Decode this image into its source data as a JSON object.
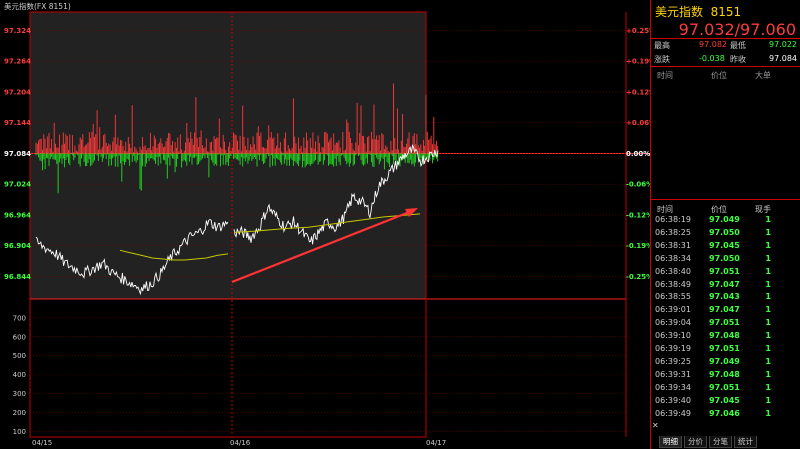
{
  "window": {
    "title": "美元指数(FX 8151)"
  },
  "chart_data": {
    "type": "line",
    "title": "美元指数(FX 8151)",
    "price_axis": [
      "97.324",
      "97.264",
      "97.204",
      "97.144",
      "97.084",
      "97.024",
      "96.964",
      "96.904",
      "96.844"
    ],
    "percent_axis": [
      "+0.25%",
      "+0.19%",
      "+0.12%",
      "+0.06%",
      "0.00%",
      "-0.06%",
      "-0.12%",
      "-0.19%",
      "-0.25%"
    ],
    "volume_axis": [
      "700",
      "600",
      "500",
      "400",
      "300",
      "200",
      "100"
    ],
    "date_labels": [
      "04/15",
      "04/16",
      "04/17"
    ],
    "ylim": [
      96.8,
      97.36
    ],
    "reference_price": 97.084,
    "series": [
      {
        "values": [
          96.91,
          96.9,
          96.89,
          96.87,
          96.86,
          96.85,
          96.86,
          96.87,
          96.85,
          96.84,
          96.83,
          96.82,
          96.83,
          96.85,
          96.88,
          96.9,
          96.92,
          96.93,
          96.95,
          96.94,
          96.95
        ]
      },
      {
        "values": [
          96.93,
          96.93,
          96.92,
          96.94,
          96.98,
          96.96,
          96.94,
          96.95,
          96.93,
          96.91,
          96.93,
          96.95,
          96.94,
          96.96,
          97.0,
          96.99,
          96.97,
          97.02,
          97.04,
          97.06,
          97.08,
          97.09,
          97.07,
          97.08,
          97.09
        ]
      },
      {
        "values": [
          96.895,
          96.89,
          96.885,
          96.88,
          96.878,
          96.876,
          96.876,
          96.878,
          96.88,
          96.885,
          96.888
        ]
      },
      {
        "values": [
          96.93,
          96.932,
          96.935,
          96.938,
          96.94,
          96.945,
          96.95,
          96.955,
          96.96,
          96.963,
          96.966
        ]
      }
    ]
  },
  "quote": {
    "name": "美元指数",
    "code": "8151",
    "price": "97.032/97.060",
    "high_label": "最高",
    "high": "97.082",
    "low_label": "最低",
    "low": "97.022",
    "change_label": "涨跌",
    "change": "-0.038",
    "prev_label": "昨收",
    "prev": "97.084"
  },
  "big_orders": {
    "col_time": "时间",
    "col_price": "价位",
    "col_big": "大单"
  },
  "ticks": {
    "col_time": "时间",
    "col_price": "价位",
    "col_qty": "现手",
    "rows": [
      {
        "time": "06:38:19",
        "price": "97.049",
        "qty": "1"
      },
      {
        "time": "06:38:25",
        "price": "97.050",
        "qty": "1"
      },
      {
        "time": "06:38:31",
        "price": "97.045",
        "qty": "1"
      },
      {
        "time": "06:38:34",
        "price": "97.050",
        "qty": "1"
      },
      {
        "time": "06:38:40",
        "price": "97.051",
        "qty": "1"
      },
      {
        "time": "06:38:49",
        "price": "97.047",
        "qty": "1"
      },
      {
        "time": "06:38:55",
        "price": "97.043",
        "qty": "1"
      },
      {
        "time": "06:39:01",
        "price": "97.047",
        "qty": "1"
      },
      {
        "time": "06:39:04",
        "price": "97.051",
        "qty": "1"
      },
      {
        "time": "06:39:10",
        "price": "97.048",
        "qty": "1"
      },
      {
        "time": "06:39:19",
        "price": "97.051",
        "qty": "1"
      },
      {
        "time": "06:39:25",
        "price": "97.049",
        "qty": "1"
      },
      {
        "time": "06:39:31",
        "price": "97.048",
        "qty": "1"
      },
      {
        "time": "06:39:34",
        "price": "97.051",
        "qty": "1"
      },
      {
        "time": "06:39:40",
        "price": "97.045",
        "qty": "1"
      },
      {
        "time": "06:39:49",
        "price": "97.046",
        "qty": "1"
      }
    ]
  },
  "tabs": [
    "明细",
    "分价",
    "分笔",
    "统计"
  ],
  "colors": {
    "up": "#ff3b3b",
    "down": "#22dd22",
    "grid": "#c00000",
    "price_line": "#ffffff",
    "avg_line": "#c8c800",
    "arrow": "#ff3333"
  }
}
